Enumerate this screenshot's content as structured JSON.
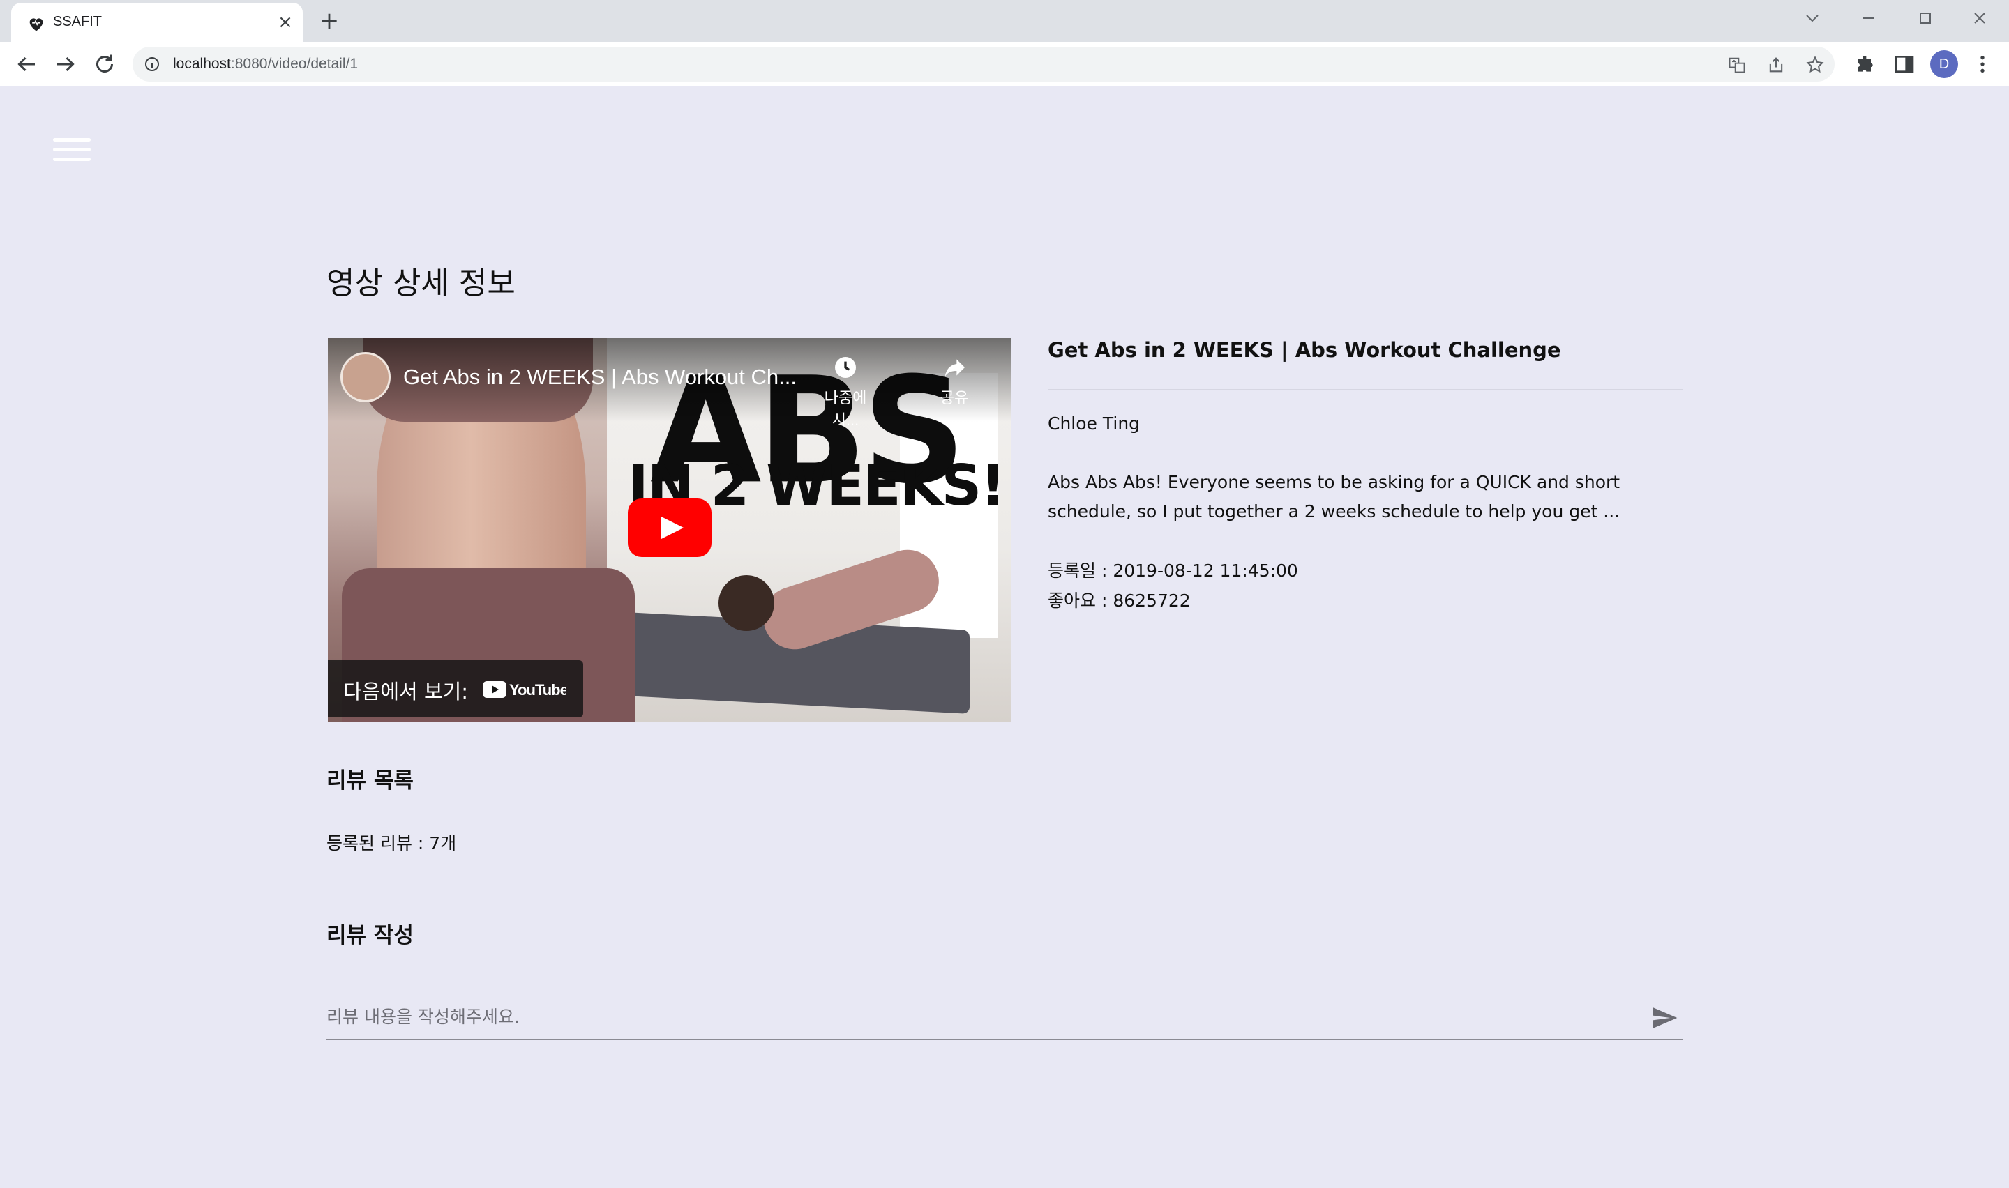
{
  "browser": {
    "tab_title": "SSAFIT",
    "url_host": "localhost",
    "url_path": ":8080/video/detail/1",
    "profile_initial": "D"
  },
  "page": {
    "title": "영상 상세 정보"
  },
  "video": {
    "player_title": "Get Abs in 2 WEEKS | Abs Workout Ch...",
    "watch_later_label": "나중에 시...",
    "share_label": "공유",
    "watch_on_label": "다음에서 보기:",
    "thumbnail_headline": "ABS",
    "thumbnail_subline": "IN 2 WEEKS!",
    "youtube_logo_text": "YouTube"
  },
  "details": {
    "title": "Get Abs in 2 WEEKS | Abs Workout Challenge",
    "channel": "Chloe Ting",
    "description": "Abs Abs Abs! Everyone seems to be asking for a QUICK and short schedule, so I put together a 2 weeks schedule to help you get ...",
    "registered": "등록일 : 2019-08-12 11:45:00",
    "likes": "좋아요 : 8625722"
  },
  "reviews": {
    "list_heading": "리뷰 목록",
    "count_text": "등록된 리뷰 : 7개",
    "write_heading": "리뷰 작성",
    "input_placeholder": "리뷰 내용을 작성해주세요."
  },
  "colors": {
    "page_background": "#e8e8f4",
    "youtube_red": "#ff0000",
    "profile_avatar": "#5c6bc0"
  }
}
